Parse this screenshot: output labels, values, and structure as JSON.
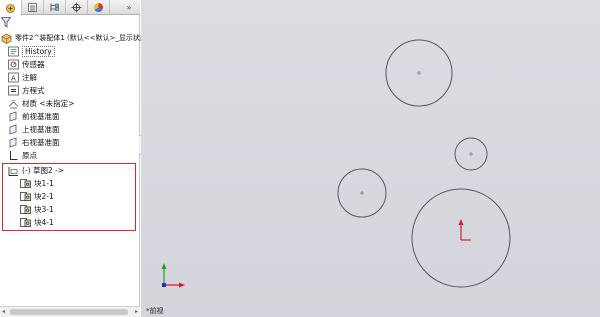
{
  "tabs": [
    {
      "name": "feature-manager-tab",
      "icon": "feature-tree-icon"
    },
    {
      "name": "property-manager-tab",
      "icon": "property-list-icon"
    },
    {
      "name": "configuration-manager-tab",
      "icon": "configuration-icon"
    },
    {
      "name": "dimxpert-manager-tab",
      "icon": "crosshair-icon"
    },
    {
      "name": "display-manager-tab",
      "icon": "color-wheel-icon"
    }
  ],
  "tab_more": "»",
  "tree": {
    "root": "零件2^装配体1 (默认<<默认>_显示状态",
    "history": "History",
    "sensors": "传感器",
    "annotations": "注解",
    "equations": "方程式",
    "material": "材质 <未指定>",
    "front_plane": "前视基准面",
    "top_plane": "上视基准面",
    "right_plane": "右视基准面",
    "origin": "原点",
    "sketch": "(-) 草图2 ->",
    "blocks": [
      "块1-1",
      "块2-1",
      "块3-1",
      "块4-1"
    ]
  },
  "collapse_handle": "«",
  "scroll_left": "◂",
  "scroll_right": "▸",
  "view_label": "*前视",
  "colors": {
    "selection_border": "#e0262e",
    "canvas_background": "#d8d9df",
    "circle_stroke": "#5a5560",
    "axis_x": "#d42020",
    "axis_y": "#1fa01f",
    "triad_z": "#2030c0"
  }
}
